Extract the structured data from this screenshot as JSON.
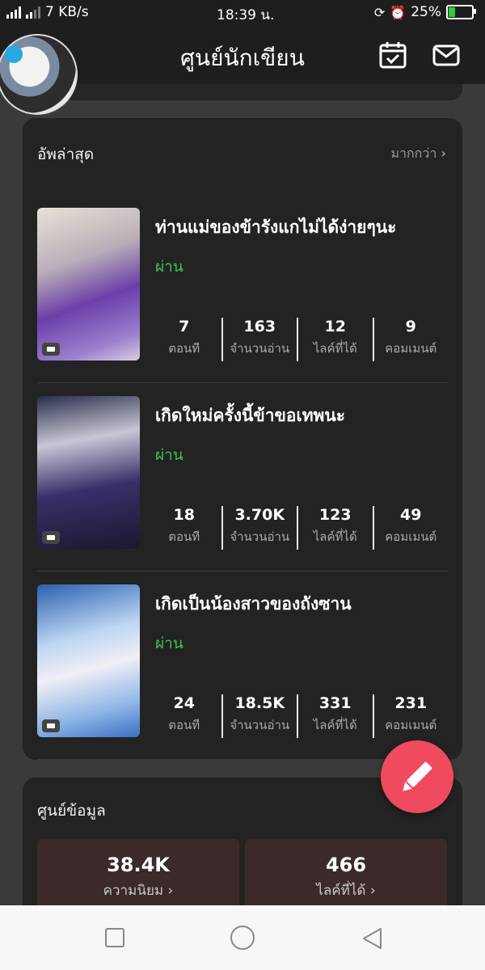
{
  "status_bar": {
    "network": "4G",
    "speed": "7 KB/s",
    "time": "18:39 น.",
    "battery": "25%",
    "battery_level": 0.25
  },
  "header": {
    "title": "ศูนย์นักเขียน",
    "icons": [
      "calendar-check-icon",
      "mail-icon"
    ]
  },
  "latest": {
    "heading": "อัพล่าสุด",
    "more_label": "มากกว่า",
    "books": [
      {
        "title": "ท่านแม่ของข้ารังแกไม่ได้ง่ายๆนะ",
        "status": "ผ่าน",
        "episodes": "7",
        "episodes_label": "ตอนที",
        "reads": "163",
        "reads_label": "จำนวนอ่าน",
        "likes": "12",
        "likes_label": "ไลค์ที่ได้",
        "comments": "9",
        "comments_label": "คอมเมนต์"
      },
      {
        "title": "เกิดใหม่ครั้งนี้ข้าขอเทพนะ",
        "status": "ผ่าน",
        "episodes": "18",
        "episodes_label": "ตอนที",
        "reads": "3.70K",
        "reads_label": "จำนวนอ่าน",
        "likes": "123",
        "likes_label": "ไลค์ที่ได้",
        "comments": "49",
        "comments_label": "คอมเมนต์"
      },
      {
        "title": "เกิดเป็นน้องสาวของถังซาน",
        "status": "ผ่าน",
        "episodes": "24",
        "episodes_label": "ตอนที",
        "reads": "18.5K",
        "reads_label": "จำนวนอ่าน",
        "likes": "331",
        "likes_label": "ไลค์ที่ได้",
        "comments": "231",
        "comments_label": "คอมเมนต์"
      }
    ]
  },
  "info_center": {
    "heading": "ศูนย์ข้อมูล",
    "tiles": [
      {
        "value": "38.4K",
        "label": "ความนิยม"
      },
      {
        "value": "466",
        "label": "ไลค์ที่ได้"
      }
    ]
  },
  "colors": {
    "accent": "#f04a5e",
    "status_green": "#3fc24c",
    "card_bg": "#232323",
    "page_bg": "#3a3a3a"
  }
}
